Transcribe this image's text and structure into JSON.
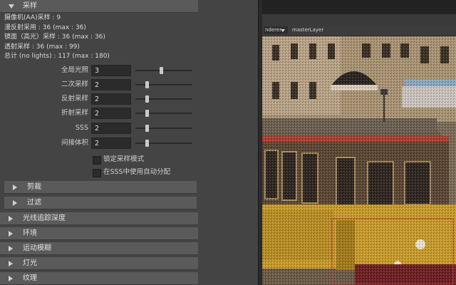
{
  "sections": {
    "sampling": "采样",
    "clipping": "剪裁",
    "filter": "过滤",
    "raytrace_depth": "光线追踪深度",
    "environment": "环境",
    "motion_blur": "运动模糊",
    "lights": "灯光",
    "texture": "纹理"
  },
  "stats": [
    "摄像机(AA)采样 : 9",
    "漫反射采用 : 36 (max : 36)",
    "镜面（高光）采样 : 36 (max : 36)",
    "透射采样 : 36 (max : 99)",
    "总计 (no lights) : 117 (max : 180)"
  ],
  "samples": [
    {
      "label": "全局光照",
      "value": "3",
      "level": 0.45
    },
    {
      "label": "二次采样",
      "value": "2",
      "level": 0.2
    },
    {
      "label": "反射采样",
      "value": "2",
      "level": 0.2
    },
    {
      "label": "折射采样",
      "value": "2",
      "level": 0.2
    },
    {
      "label": "SSS",
      "value": "2",
      "level": 0.2
    },
    {
      "label": "间接体积",
      "value": "2",
      "level": 0.2
    }
  ],
  "checkboxes": {
    "lock_sampling": "锁定采样模式",
    "sss_auto": "在SSS中使用自动分配"
  },
  "viewport": {
    "renderer": "nderer",
    "layer": "masterLayer"
  },
  "colors": {
    "panel_bg": "#444444",
    "section_header": "#5a5a5a",
    "input_bg": "#2b2b2b",
    "tram_yellow": "#c79a2a"
  }
}
